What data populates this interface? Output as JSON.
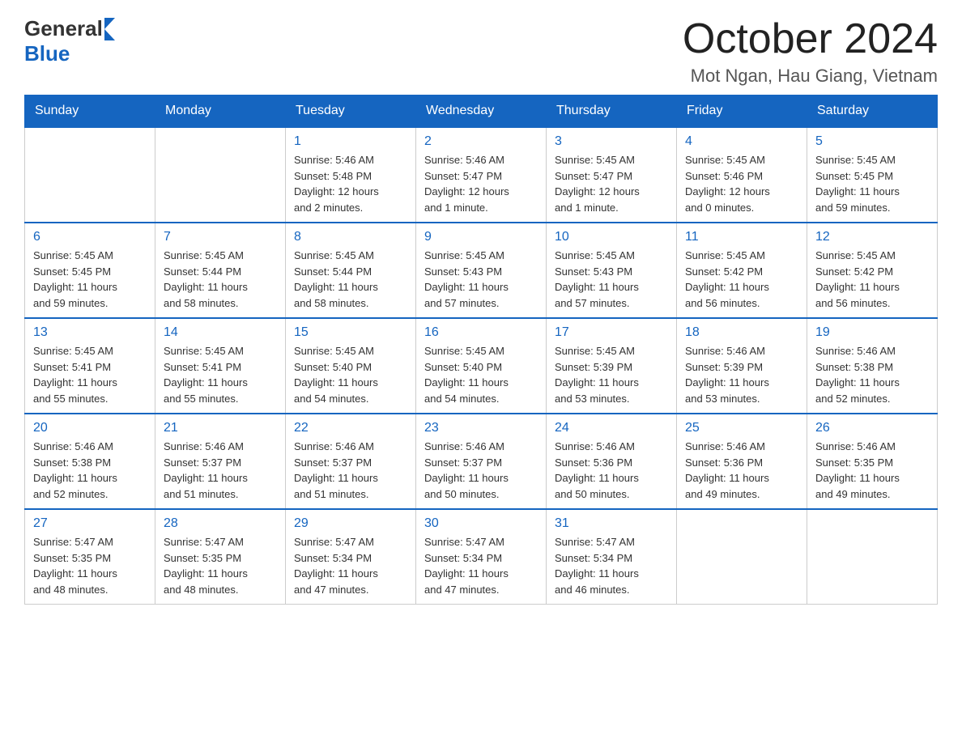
{
  "header": {
    "logo": {
      "general": "General",
      "blue": "Blue",
      "triangle": "▶"
    },
    "title": "October 2024",
    "location": "Mot Ngan, Hau Giang, Vietnam"
  },
  "calendar": {
    "days_of_week": [
      "Sunday",
      "Monday",
      "Tuesday",
      "Wednesday",
      "Thursday",
      "Friday",
      "Saturday"
    ],
    "weeks": [
      [
        {
          "day": "",
          "info": ""
        },
        {
          "day": "",
          "info": ""
        },
        {
          "day": "1",
          "info": "Sunrise: 5:46 AM\nSunset: 5:48 PM\nDaylight: 12 hours\nand 2 minutes."
        },
        {
          "day": "2",
          "info": "Sunrise: 5:46 AM\nSunset: 5:47 PM\nDaylight: 12 hours\nand 1 minute."
        },
        {
          "day": "3",
          "info": "Sunrise: 5:45 AM\nSunset: 5:47 PM\nDaylight: 12 hours\nand 1 minute."
        },
        {
          "day": "4",
          "info": "Sunrise: 5:45 AM\nSunset: 5:46 PM\nDaylight: 12 hours\nand 0 minutes."
        },
        {
          "day": "5",
          "info": "Sunrise: 5:45 AM\nSunset: 5:45 PM\nDaylight: 11 hours\nand 59 minutes."
        }
      ],
      [
        {
          "day": "6",
          "info": "Sunrise: 5:45 AM\nSunset: 5:45 PM\nDaylight: 11 hours\nand 59 minutes."
        },
        {
          "day": "7",
          "info": "Sunrise: 5:45 AM\nSunset: 5:44 PM\nDaylight: 11 hours\nand 58 minutes."
        },
        {
          "day": "8",
          "info": "Sunrise: 5:45 AM\nSunset: 5:44 PM\nDaylight: 11 hours\nand 58 minutes."
        },
        {
          "day": "9",
          "info": "Sunrise: 5:45 AM\nSunset: 5:43 PM\nDaylight: 11 hours\nand 57 minutes."
        },
        {
          "day": "10",
          "info": "Sunrise: 5:45 AM\nSunset: 5:43 PM\nDaylight: 11 hours\nand 57 minutes."
        },
        {
          "day": "11",
          "info": "Sunrise: 5:45 AM\nSunset: 5:42 PM\nDaylight: 11 hours\nand 56 minutes."
        },
        {
          "day": "12",
          "info": "Sunrise: 5:45 AM\nSunset: 5:42 PM\nDaylight: 11 hours\nand 56 minutes."
        }
      ],
      [
        {
          "day": "13",
          "info": "Sunrise: 5:45 AM\nSunset: 5:41 PM\nDaylight: 11 hours\nand 55 minutes."
        },
        {
          "day": "14",
          "info": "Sunrise: 5:45 AM\nSunset: 5:41 PM\nDaylight: 11 hours\nand 55 minutes."
        },
        {
          "day": "15",
          "info": "Sunrise: 5:45 AM\nSunset: 5:40 PM\nDaylight: 11 hours\nand 54 minutes."
        },
        {
          "day": "16",
          "info": "Sunrise: 5:45 AM\nSunset: 5:40 PM\nDaylight: 11 hours\nand 54 minutes."
        },
        {
          "day": "17",
          "info": "Sunrise: 5:45 AM\nSunset: 5:39 PM\nDaylight: 11 hours\nand 53 minutes."
        },
        {
          "day": "18",
          "info": "Sunrise: 5:46 AM\nSunset: 5:39 PM\nDaylight: 11 hours\nand 53 minutes."
        },
        {
          "day": "19",
          "info": "Sunrise: 5:46 AM\nSunset: 5:38 PM\nDaylight: 11 hours\nand 52 minutes."
        }
      ],
      [
        {
          "day": "20",
          "info": "Sunrise: 5:46 AM\nSunset: 5:38 PM\nDaylight: 11 hours\nand 52 minutes."
        },
        {
          "day": "21",
          "info": "Sunrise: 5:46 AM\nSunset: 5:37 PM\nDaylight: 11 hours\nand 51 minutes."
        },
        {
          "day": "22",
          "info": "Sunrise: 5:46 AM\nSunset: 5:37 PM\nDaylight: 11 hours\nand 51 minutes."
        },
        {
          "day": "23",
          "info": "Sunrise: 5:46 AM\nSunset: 5:37 PM\nDaylight: 11 hours\nand 50 minutes."
        },
        {
          "day": "24",
          "info": "Sunrise: 5:46 AM\nSunset: 5:36 PM\nDaylight: 11 hours\nand 50 minutes."
        },
        {
          "day": "25",
          "info": "Sunrise: 5:46 AM\nSunset: 5:36 PM\nDaylight: 11 hours\nand 49 minutes."
        },
        {
          "day": "26",
          "info": "Sunrise: 5:46 AM\nSunset: 5:35 PM\nDaylight: 11 hours\nand 49 minutes."
        }
      ],
      [
        {
          "day": "27",
          "info": "Sunrise: 5:47 AM\nSunset: 5:35 PM\nDaylight: 11 hours\nand 48 minutes."
        },
        {
          "day": "28",
          "info": "Sunrise: 5:47 AM\nSunset: 5:35 PM\nDaylight: 11 hours\nand 48 minutes."
        },
        {
          "day": "29",
          "info": "Sunrise: 5:47 AM\nSunset: 5:34 PM\nDaylight: 11 hours\nand 47 minutes."
        },
        {
          "day": "30",
          "info": "Sunrise: 5:47 AM\nSunset: 5:34 PM\nDaylight: 11 hours\nand 47 minutes."
        },
        {
          "day": "31",
          "info": "Sunrise: 5:47 AM\nSunset: 5:34 PM\nDaylight: 11 hours\nand 46 minutes."
        },
        {
          "day": "",
          "info": ""
        },
        {
          "day": "",
          "info": ""
        }
      ]
    ]
  }
}
